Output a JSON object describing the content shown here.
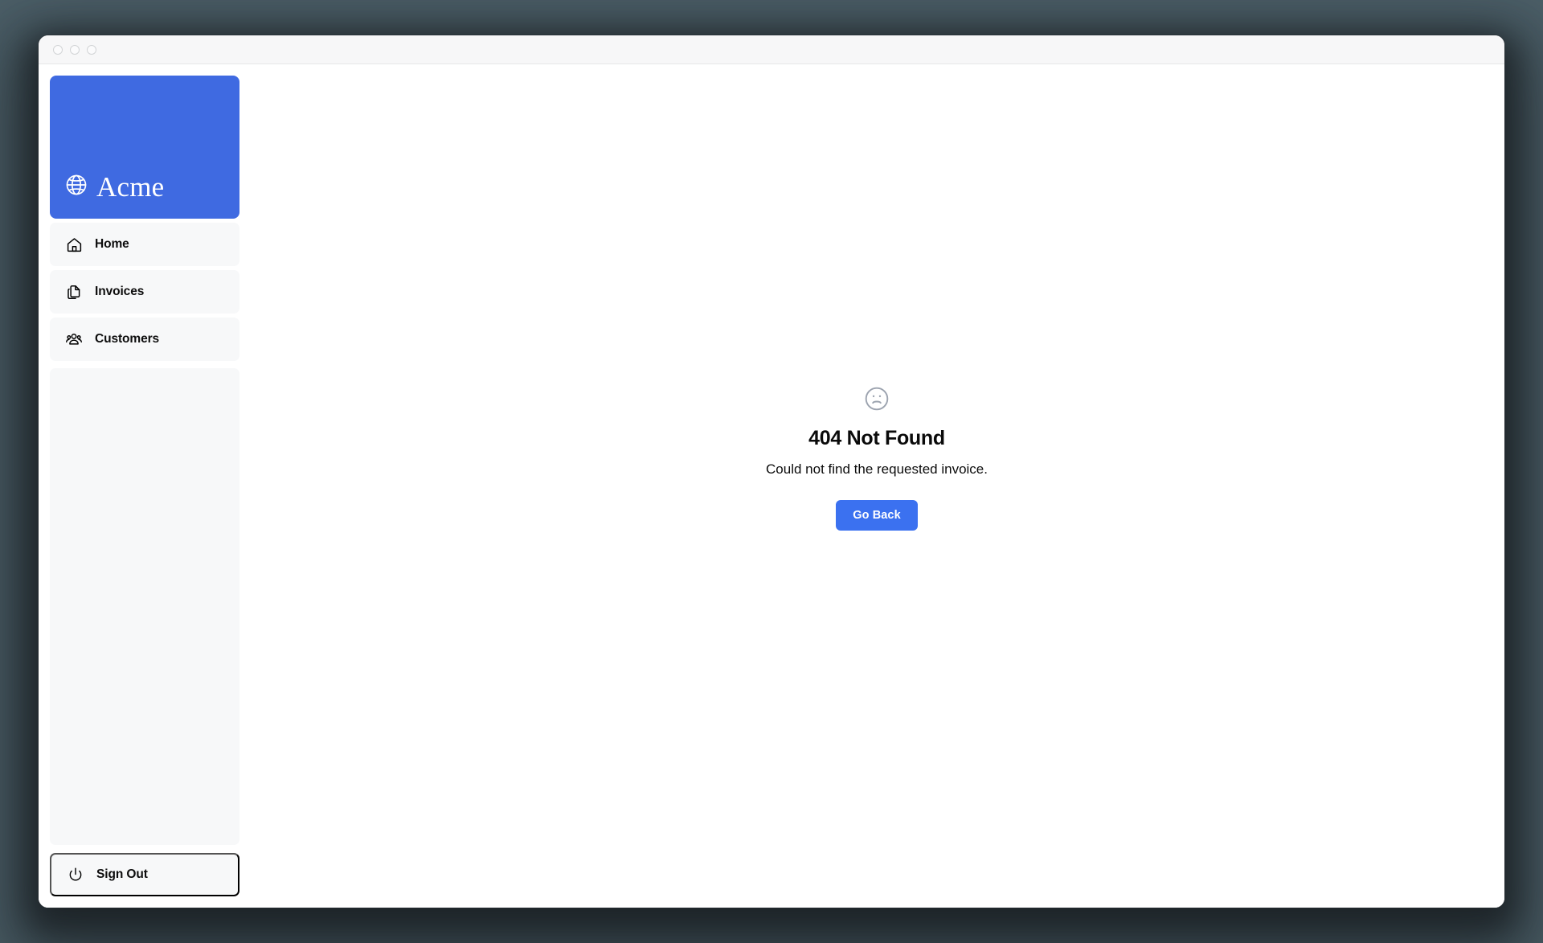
{
  "window": {
    "traffic_lights": [
      "close-dot",
      "minimize-dot",
      "maximize-dot"
    ]
  },
  "sidebar": {
    "brand": {
      "name": "Acme",
      "icon": "globe-icon",
      "background_color": "#3f6ae1"
    },
    "items": [
      {
        "label": "Home",
        "icon": "home-icon"
      },
      {
        "label": "Invoices",
        "icon": "document-duplicate-icon"
      },
      {
        "label": "Customers",
        "icon": "user-group-icon"
      }
    ],
    "sign_out": {
      "label": "Sign Out",
      "icon": "power-icon"
    }
  },
  "main": {
    "error": {
      "icon": "face-frown-icon",
      "title": "404 Not Found",
      "message": "Could not find the requested invoice.",
      "button_label": "Go Back",
      "button_color": "#3b71f0"
    }
  },
  "colors": {
    "desktop_background": "#4c5f68",
    "brand_blue": "#3f6ae1",
    "accent_blue": "#3b71f0",
    "nav_item_background": "#f7f8f9",
    "title_bar_background": "#f7f7f8",
    "text_primary": "#0a0a0a",
    "icon_muted": "#9ca3af"
  }
}
